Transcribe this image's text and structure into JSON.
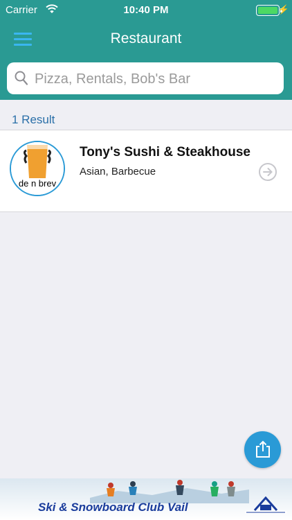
{
  "status_bar": {
    "carrier": "Carrier",
    "time": "10:40 PM",
    "battery_level": 1.0,
    "battery_color": "#4cd964"
  },
  "nav": {
    "title": "Restaurant",
    "menu_icon": "hamburger-menu-icon",
    "bar_color": "#2a9a93"
  },
  "search": {
    "placeholder": "Pizza, Rentals, Bob's Bar",
    "value": "",
    "icon": "search-icon"
  },
  "results": {
    "count_label": "1 Result",
    "items": [
      {
        "name": "Tony's Sushi & Steakhouse",
        "category": "Asian, Barbecue",
        "logo_text": "de n brev",
        "arrow_icon": "arrow-right-circle-icon"
      }
    ]
  },
  "fab": {
    "icon": "share-icon",
    "color": "#2a9ad6"
  },
  "banner": {
    "text": "Ski & Snowboard Club Vail"
  }
}
